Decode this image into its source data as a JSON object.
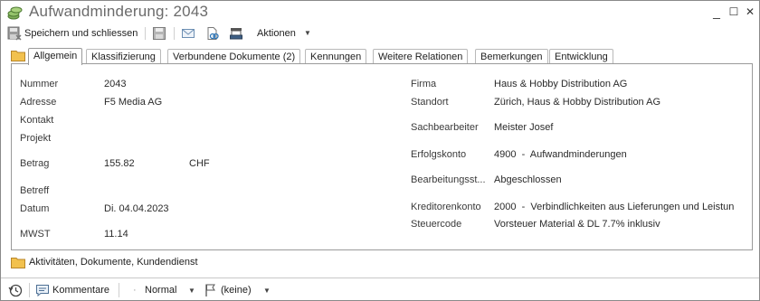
{
  "window": {
    "title": "Aufwandminderung: 2043",
    "controls": {
      "minimize": "_",
      "maximize": "☐",
      "close": "✕"
    }
  },
  "toolbar": {
    "save_close_label": "Speichern und schliessen",
    "actions_label": "Aktionen",
    "actions_caret": "▼"
  },
  "tabs": [
    {
      "label": "Allgemein",
      "active": true
    },
    {
      "label": "Klassifizierung"
    },
    {
      "label": "Verbundene Dokumente (2)"
    },
    {
      "label": "Kennungen"
    },
    {
      "label": "Weitere Relationen"
    },
    {
      "label": "Bemerkungen"
    },
    {
      "label": "Entwicklung"
    }
  ],
  "left_fields": {
    "nummer": {
      "label": "Nummer",
      "value": "2043"
    },
    "adresse": {
      "label": "Adresse",
      "value": "F5 Media AG"
    },
    "kontakt": {
      "label": "Kontakt",
      "value": ""
    },
    "projekt": {
      "label": "Projekt",
      "value": ""
    },
    "betrag": {
      "label": "Betrag",
      "value": "155.82",
      "currency": "CHF"
    },
    "betreff": {
      "label": "Betreff",
      "value": ""
    },
    "datum": {
      "label": "Datum",
      "value": "Di. 04.04.2023"
    },
    "mwst": {
      "label": "MWST",
      "value": "11.14"
    }
  },
  "right_fields": {
    "firma": {
      "label": "Firma",
      "value": "Haus & Hobby Distribution AG"
    },
    "standort": {
      "label": "Standort",
      "value": "Zürich, Haus & Hobby Distribution AG"
    },
    "sachbearbeiter": {
      "label": "Sachbearbeiter",
      "value": "Meister Josef"
    },
    "erfolgskonto": {
      "label": "Erfolgskonto",
      "value": "4900  -  Aufwandminderungen"
    },
    "bearbeitungsstatus": {
      "label": "Bearbeitungsst...",
      "value": "Abgeschlossen"
    },
    "kreditorenkonto": {
      "label": "Kreditorenkonto",
      "value": "2000  -  Verbindlichkeiten aus Lieferungen und Leistun"
    },
    "steuercode": {
      "label": "Steuercode",
      "value": "Vorsteuer Material & DL 7.7% inklusiv"
    }
  },
  "lower_section": {
    "label": "Aktivitäten, Dokumente, Kundendienst"
  },
  "statusbar": {
    "comments_label": "Kommentare",
    "priority_label": "Normal",
    "flag_label": "(keine)",
    "caret": "▼"
  },
  "colors": {
    "accent": "#2e75b6",
    "folder": "#f2c14e",
    "border": "#9a9a9a"
  }
}
